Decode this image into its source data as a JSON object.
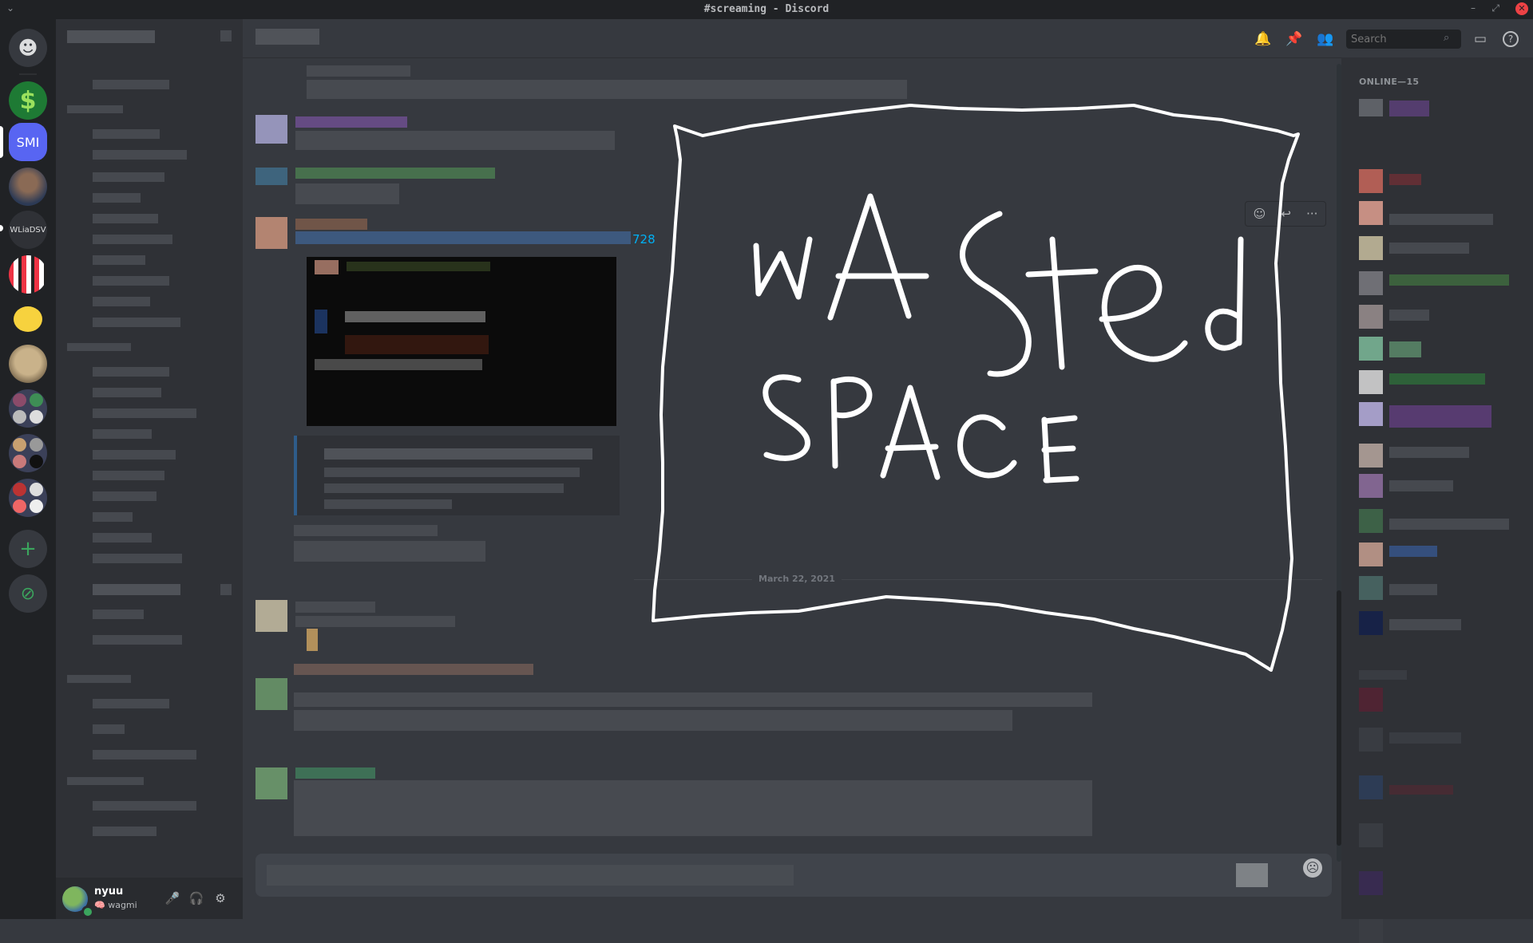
{
  "window": {
    "title": "#screaming - Discord",
    "menu_glyph": "⌄",
    "minimize": "–",
    "maximize": "⤢",
    "close": "✕"
  },
  "servers": [
    {
      "name": "home",
      "glyph": "☻"
    },
    {
      "name": "money",
      "glyph": "$"
    },
    {
      "name": "SMI",
      "glyph": "SMI"
    },
    {
      "name": "portrait",
      "glyph": ""
    },
    {
      "name": "WLiaDSV",
      "glyph": "WLiaDSV"
    },
    {
      "name": "bars",
      "glyph": ""
    },
    {
      "name": "duck",
      "glyph": ""
    },
    {
      "name": "statue",
      "glyph": ""
    },
    {
      "name": "add",
      "glyph": "+"
    },
    {
      "name": "discover",
      "glyph": "⊘"
    }
  ],
  "header": {
    "search_placeholder": "Search",
    "icons": {
      "bell": "🔔",
      "pin": "📌",
      "members": "👥",
      "inbox": "▭",
      "help": "?"
    }
  },
  "chat": {
    "date_divider": "March 22, 2021",
    "link_fragment": "728",
    "drawing": {
      "line1": "wAS",
      "line1b": "ted",
      "line2": "SPACE"
    },
    "actions": {
      "react": "☺",
      "reply": "↩",
      "more": "···"
    }
  },
  "members": {
    "online_header": "ONLINE—15"
  },
  "user": {
    "name": "nyuu",
    "status": "wagmi",
    "status_emoji": "🧠",
    "mic": "🎤",
    "headset": "🎧",
    "settings": "⚙"
  },
  "composer": {
    "emoji": "☹"
  }
}
